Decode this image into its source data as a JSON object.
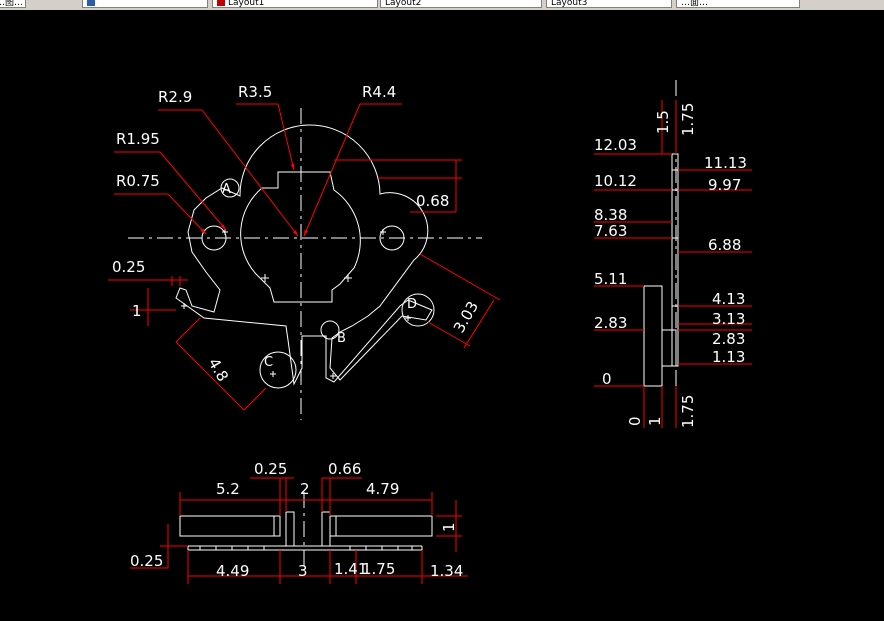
{
  "tabs": [
    {
      "label": "…图…",
      "icon_color": "#000000"
    },
    {
      "label": "",
      "icon_color": "#2a5caa"
    },
    {
      "label": "Layout1",
      "icon_color": "#c00000"
    },
    {
      "label": "Layout2",
      "icon_color": ""
    },
    {
      "label": "Layout3",
      "icon_color": ""
    },
    {
      "label": "…面…",
      "icon_color": ""
    }
  ],
  "colors": {
    "background": "#000000",
    "geometry": "#ffffff",
    "dimension": "#ff0000"
  },
  "dims": {
    "front": {
      "r29": "R2.9",
      "r35": "R3.5",
      "r44": "R4.4",
      "r195": "R1.95",
      "r075": "R0.75",
      "d068": "0.68",
      "d025": "0.25",
      "d1": "1",
      "d48": "4.8",
      "d303": "3.03",
      "markA": "A",
      "markB": "B",
      "markC": "C",
      "markD": "D"
    },
    "side": {
      "top_15": "1.5",
      "top_175": "1.75",
      "l1203": "12.03",
      "l1012": "10.12",
      "l838": "8.38",
      "l763": "7.63",
      "l511": "5.11",
      "l283": "2.83",
      "l0": "0",
      "r1113": "11.13",
      "r997": "9.97",
      "r688": "6.88",
      "r413": "4.13",
      "r313": "3.13",
      "r283": "2.83",
      "r113": "1.13",
      "bot_0": "0",
      "bot_1": "1",
      "bot_175": "1.75"
    },
    "bottom": {
      "t52": "5.2",
      "t025": "0.25",
      "t2": "2",
      "t066": "0.66",
      "t479": "4.79",
      "r1": "1",
      "l025": "0.25",
      "b449": "4.49",
      "b3": "3",
      "b141": "1.41",
      "b175": "1.75",
      "b134": "1.34"
    }
  }
}
